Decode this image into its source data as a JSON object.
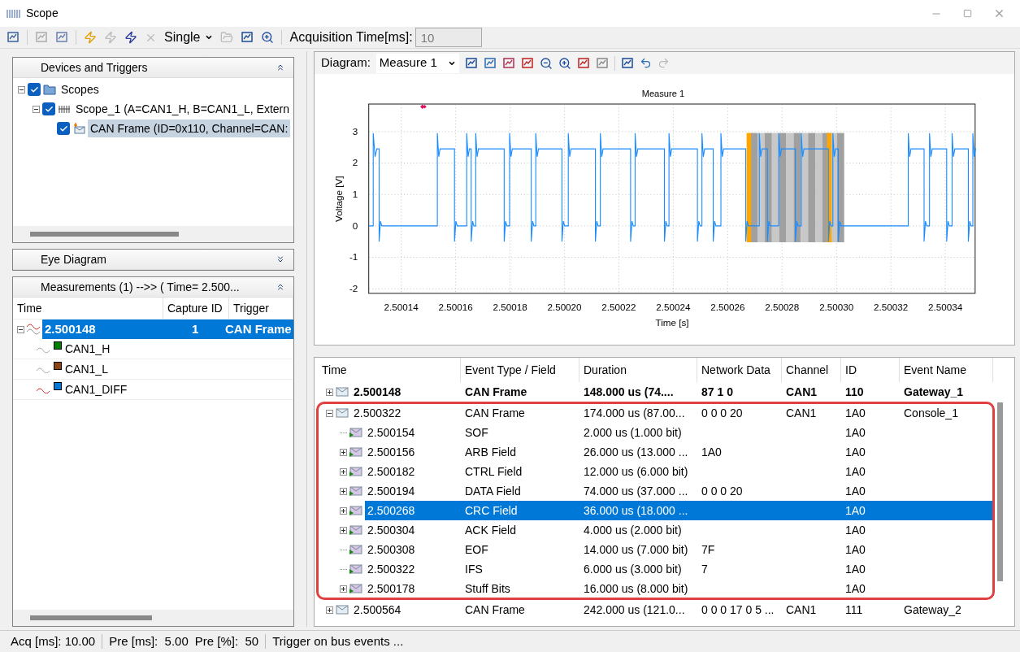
{
  "window": {
    "title": "Scope"
  },
  "toolbar": {
    "mode": "Single",
    "acq_label": "Acquisition Time[ms]:",
    "acq_value": "10"
  },
  "devices_panel": {
    "title": "Devices and Triggers",
    "tree": [
      {
        "label": "Scopes",
        "checked": true,
        "expanded": true,
        "selected": false,
        "children": [
          {
            "label": "Scope_1 (A=CAN1_H, B=CAN1_L, Extern",
            "checked": true,
            "expanded": true,
            "selected": false,
            "children": [
              {
                "label": "CAN Frame (ID=0x110, Channel=CAN:",
                "checked": true,
                "selected": true
              }
            ]
          }
        ]
      }
    ]
  },
  "eye_panel": {
    "title": "Eye Diagram",
    "expanded": false
  },
  "measurements_panel": {
    "title": "Measurements (1)   -->> ( Time=  2.500...",
    "expanded": true,
    "columns": [
      "Time",
      "Capture ID",
      "Trigger"
    ],
    "rows": [
      {
        "time": "2.500148",
        "capture_id": "1",
        "trigger": "CAN Frame",
        "selected": true,
        "expanded": true,
        "children": [
          {
            "label": "CAN1_H",
            "color": "#008000"
          },
          {
            "label": "CAN1_L",
            "color": "#8b4513"
          },
          {
            "label": "CAN1_DIFF",
            "color": "#0078d7"
          }
        ]
      }
    ]
  },
  "diagram": {
    "label": "Diagram:",
    "selector": "Measure 1",
    "title": "Measure 1",
    "xlabel": "Time [s]",
    "ylabel": "Voltage [V]",
    "xticks": [
      "2.50014",
      "2.50016",
      "2.50018",
      "2.50020",
      "2.50022",
      "2.50024",
      "2.50026",
      "2.50028",
      "2.50030",
      "2.50032",
      "2.50034"
    ],
    "yticks": [
      "3",
      "2",
      "1",
      "0",
      "-1",
      "-2"
    ]
  },
  "events": {
    "columns": [
      "Time",
      "Event Type / Field",
      "Duration",
      "Network Data",
      "Channel",
      "ID",
      "Event Name"
    ],
    "rows": [
      {
        "time": "2.500148",
        "type": "CAN Frame",
        "duration": "148.000 us (74....",
        "data": "87 1 0",
        "channel": "CAN1",
        "id": "110",
        "name": "Gateway_1",
        "bold": true,
        "expanded": false
      },
      {
        "time": "2.500322",
        "type": "CAN Frame",
        "duration": "174.000 us (87.00...",
        "data": "0 0 0 20",
        "channel": "CAN1",
        "id": "1A0",
        "name": "Console_1",
        "bold": false,
        "expanded": true,
        "children": [
          {
            "time": "2.500154",
            "type": "SOF",
            "duration": "2.000 us (1.000 bit)",
            "id": "1A0",
            "kind": "leaf",
            "selected": false
          },
          {
            "time": "2.500156",
            "type": "ARB Field",
            "duration": "26.000 us (13.000 ...",
            "data": "1A0",
            "id": "1A0",
            "kind": "group",
            "selected": false
          },
          {
            "time": "2.500182",
            "type": "CTRL Field",
            "duration": "12.000 us (6.000 bit)",
            "id": "1A0",
            "kind": "group",
            "selected": false
          },
          {
            "time": "2.500194",
            "type": "DATA Field",
            "duration": "74.000 us (37.000 ...",
            "data": "0 0 0 20",
            "id": "1A0",
            "kind": "group",
            "selected": false
          },
          {
            "time": "2.500268",
            "type": "CRC Field",
            "duration": "36.000 us (18.000 ...",
            "id": "1A0",
            "kind": "group",
            "selected": true
          },
          {
            "time": "2.500304",
            "type": "ACK Field",
            "duration": "4.000 us (2.000 bit)",
            "id": "1A0",
            "kind": "group",
            "selected": false
          },
          {
            "time": "2.500308",
            "type": "EOF",
            "duration": "14.000 us (7.000 bit)",
            "data": "7F",
            "id": "1A0",
            "kind": "leaf",
            "selected": false
          },
          {
            "time": "2.500322",
            "type": "IFS",
            "duration": "6.000 us (3.000 bit)",
            "data": "7",
            "id": "1A0",
            "kind": "leaf",
            "selected": false
          },
          {
            "time": "2.500178",
            "type": "Stuff Bits",
            "duration": "16.000 us (8.000 bit)",
            "id": "1A0",
            "kind": "group",
            "selected": false
          }
        ]
      },
      {
        "time": "2.500564",
        "type": "CAN Frame",
        "duration": "242.000 us (121.0...",
        "data": "0 0 0 17 0 5 ...",
        "channel": "CAN1",
        "id": "111",
        "name": "Gateway_2",
        "bold": false,
        "expanded": false
      }
    ]
  },
  "status_bar": [
    "Acq [ms]: 10.00",
    "Pre [ms]:  5.00",
    "Pre [%]:  50",
    "Trigger on bus events ..."
  ]
}
